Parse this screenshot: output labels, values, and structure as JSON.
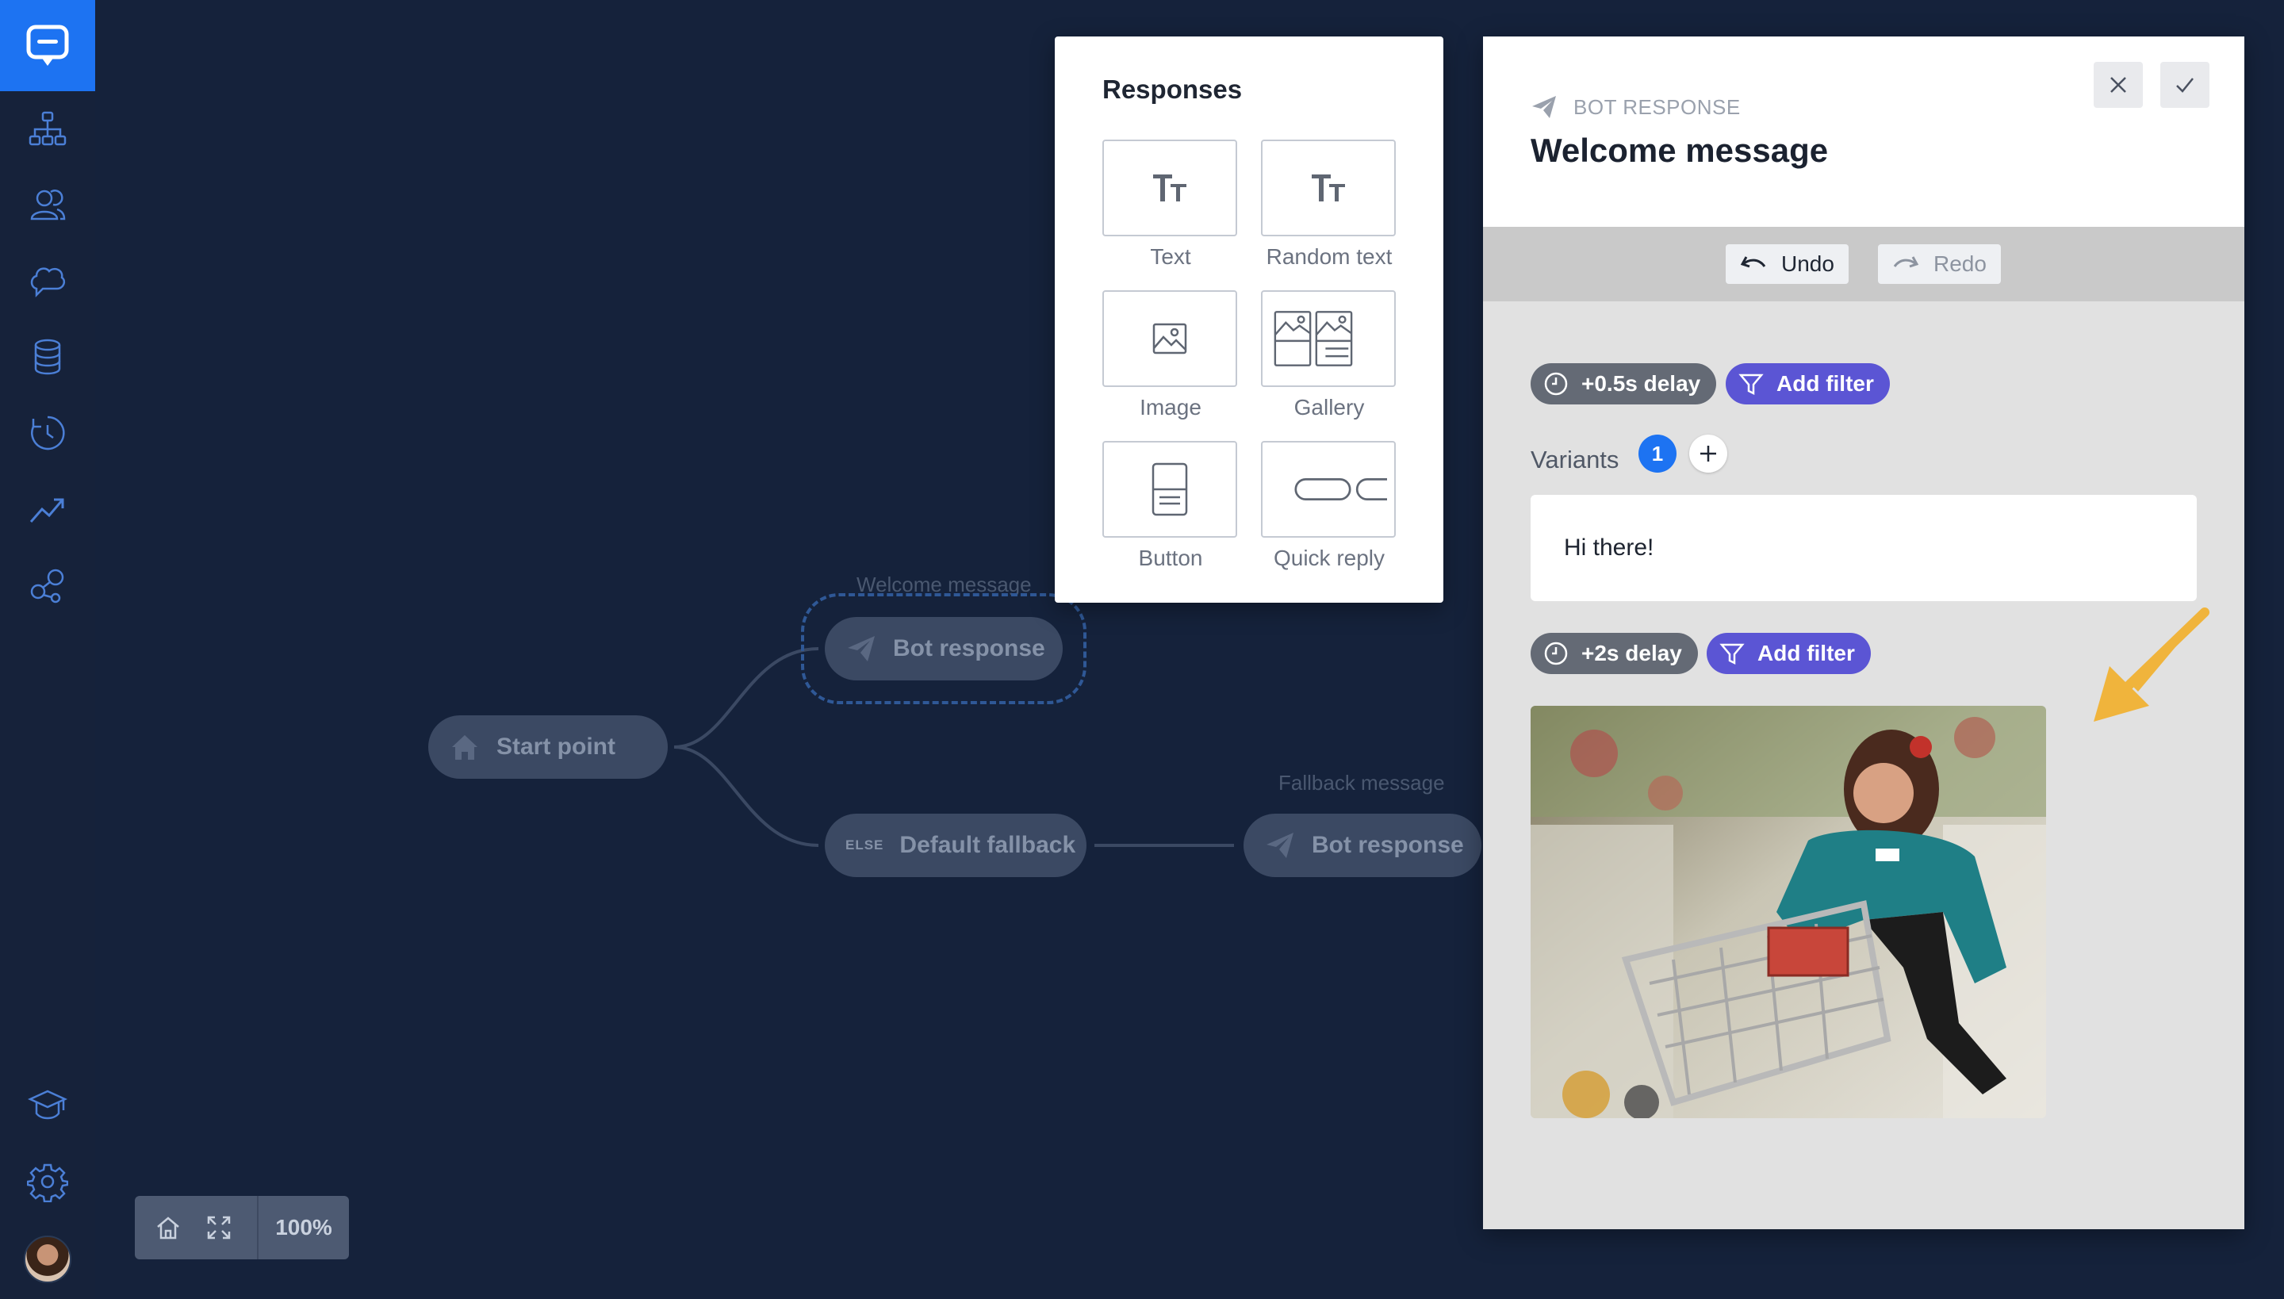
{
  "sidebar": {
    "items": [
      {
        "name": "logo",
        "icon": "chat-logo-icon"
      },
      {
        "name": "stories",
        "icon": "flow-tree-icon"
      },
      {
        "name": "audience",
        "icon": "users-icon"
      },
      {
        "name": "training",
        "icon": "brain-bubble-icon"
      },
      {
        "name": "data",
        "icon": "database-icon"
      },
      {
        "name": "history",
        "icon": "clock-history-icon"
      },
      {
        "name": "analytics",
        "icon": "trend-chart-icon"
      },
      {
        "name": "integrations",
        "icon": "integration-nodes-icon"
      },
      {
        "name": "academy",
        "icon": "graduation-cap-icon"
      },
      {
        "name": "settings",
        "icon": "gear-icon"
      }
    ],
    "accent": "#1d73f2"
  },
  "canvas": {
    "start_point": "Start point",
    "welcome_label": "Welcome message",
    "bot_response_1": "Bot response",
    "else_tag": "ELSE",
    "default_fallback": "Default fallback",
    "fallback_label": "Fallback message",
    "bot_response_2": "Bot response",
    "zoom": "100%"
  },
  "responses": {
    "title": "Responses",
    "tiles": [
      {
        "label": "Text",
        "icon": "text-icon"
      },
      {
        "label": "Random text",
        "icon": "random-text-icon"
      },
      {
        "label": "Image",
        "icon": "image-icon"
      },
      {
        "label": "Gallery",
        "icon": "gallery-icon"
      },
      {
        "label": "Button",
        "icon": "button-icon"
      },
      {
        "label": "Quick reply",
        "icon": "quick-reply-icon"
      }
    ]
  },
  "panel": {
    "subtitle": "BOT RESPONSE",
    "title": "Welcome message",
    "undo": "Undo",
    "redo": "Redo",
    "delay_1": "+0.5s delay",
    "filter_1": "Add filter",
    "variants_label": "Variants",
    "variants_count": "1",
    "message": "Hi there!",
    "delay_2": "+2s delay",
    "filter_2": "Add filter",
    "colors": {
      "filter": "#5b55d4",
      "delay": "#646a75",
      "hint_arrow": "#f0b43c"
    }
  }
}
